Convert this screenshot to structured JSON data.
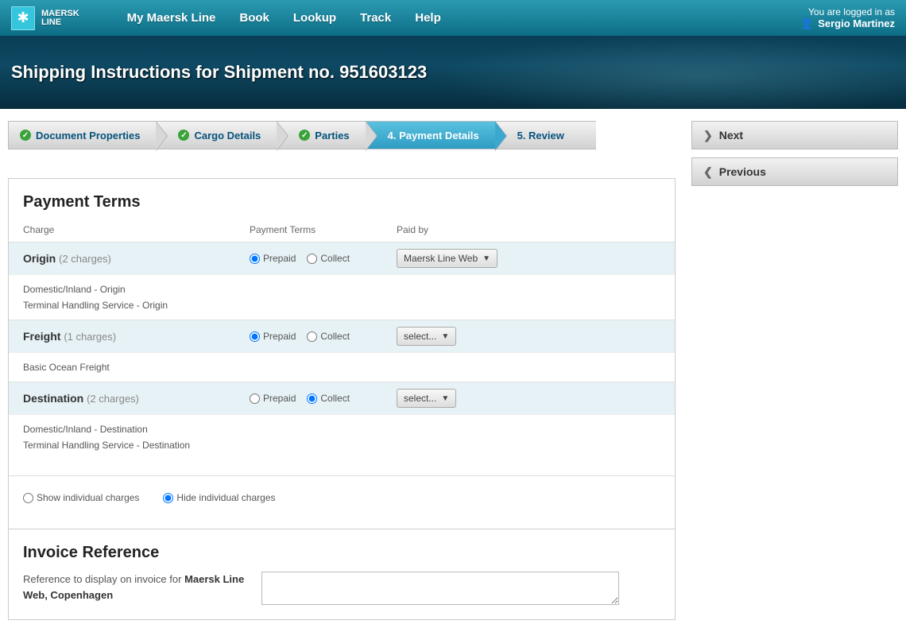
{
  "header": {
    "brand_top": "MAERSK",
    "brand_bottom": "LINE",
    "nav": [
      "My Maersk Line",
      "Book",
      "Lookup",
      "Track",
      "Help"
    ],
    "login_prefix": "You are logged in as",
    "user_name": "Sergio Martinez"
  },
  "page_title": "Shipping Instructions for Shipment no. 951603123",
  "steps": [
    {
      "label": "Document Properties",
      "done": true
    },
    {
      "label": "Cargo Details",
      "done": true
    },
    {
      "label": "Parties",
      "done": true
    },
    {
      "label": "4.  Payment Details",
      "active": true
    },
    {
      "label": "5.  Review"
    }
  ],
  "side": {
    "next": "Next",
    "prev": "Previous"
  },
  "payment_terms": {
    "title": "Payment Terms",
    "cols": {
      "charge": "Charge",
      "terms": "Payment Terms",
      "paid": "Paid by"
    },
    "labels": {
      "prepaid": "Prepaid",
      "collect": "Collect"
    },
    "groups": [
      {
        "name": "Origin",
        "count_label": "(2 charges)",
        "selected": "prepaid",
        "paid_by": "Maersk Line Web",
        "lines": [
          "Domestic/Inland - Origin",
          "Terminal Handling Service - Origin"
        ]
      },
      {
        "name": "Freight",
        "count_label": "(1 charges)",
        "selected": "prepaid",
        "paid_by": "select...",
        "lines": [
          "Basic Ocean Freight"
        ]
      },
      {
        "name": "Destination",
        "count_label": "(2 charges)",
        "selected": "collect",
        "paid_by": "select...",
        "lines": [
          "Domestic/Inland - Destination",
          "Terminal Handling Service - Destination"
        ]
      }
    ],
    "toggle": {
      "show": "Show individual charges",
      "hide": "Hide individual charges",
      "selected": "hide"
    }
  },
  "invoice": {
    "title": "Invoice Reference",
    "label_pre": "Reference to display on invoice for ",
    "label_bold": "Maersk Line Web, Copenhagen",
    "value": ""
  }
}
